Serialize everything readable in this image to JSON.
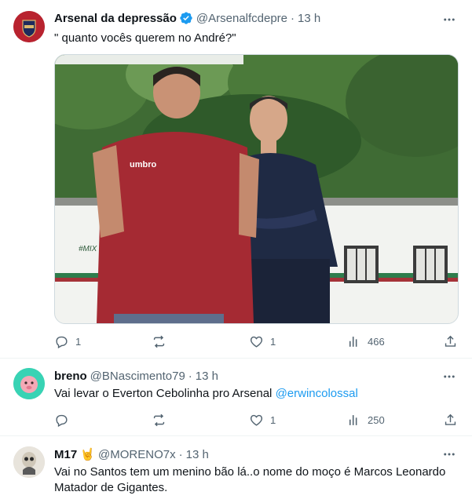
{
  "tweets": [
    {
      "name": "Arsenal da depressão",
      "handle": "@Arsenalfcdepre",
      "time": "13 h",
      "text": "\" quanto vocês querem no André?\"",
      "replies": "1",
      "retweets": "",
      "likes": "1",
      "views": "466"
    },
    {
      "name": "breno",
      "handle": "@BNascimento79",
      "time": "13 h",
      "text": "Vai levar o Everton Cebolinha pro Arsenal ",
      "mention": "@erwincolossal",
      "replies": "",
      "retweets": "",
      "likes": "1",
      "views": "250"
    },
    {
      "name": "M17 🤘",
      "handle": "@MORENO7x",
      "time": "13 h",
      "text_line1": "Vai no Santos  tem um menino bão lá..o nome do moço é Marcos Leonardo",
      "text_line2": "Matador de Gigantes."
    }
  ],
  "media": {
    "shirt_text": "umbro",
    "wall_text": "#MIX DE XEREM"
  },
  "colors": {
    "accent": "#1d9bf0",
    "muted": "#536471",
    "shirt": "#a52a33"
  },
  "icons": [
    "verified-badge-icon",
    "more-options-icon",
    "reply-icon",
    "retweet-icon",
    "like-icon",
    "views-icon",
    "share-icon"
  ]
}
